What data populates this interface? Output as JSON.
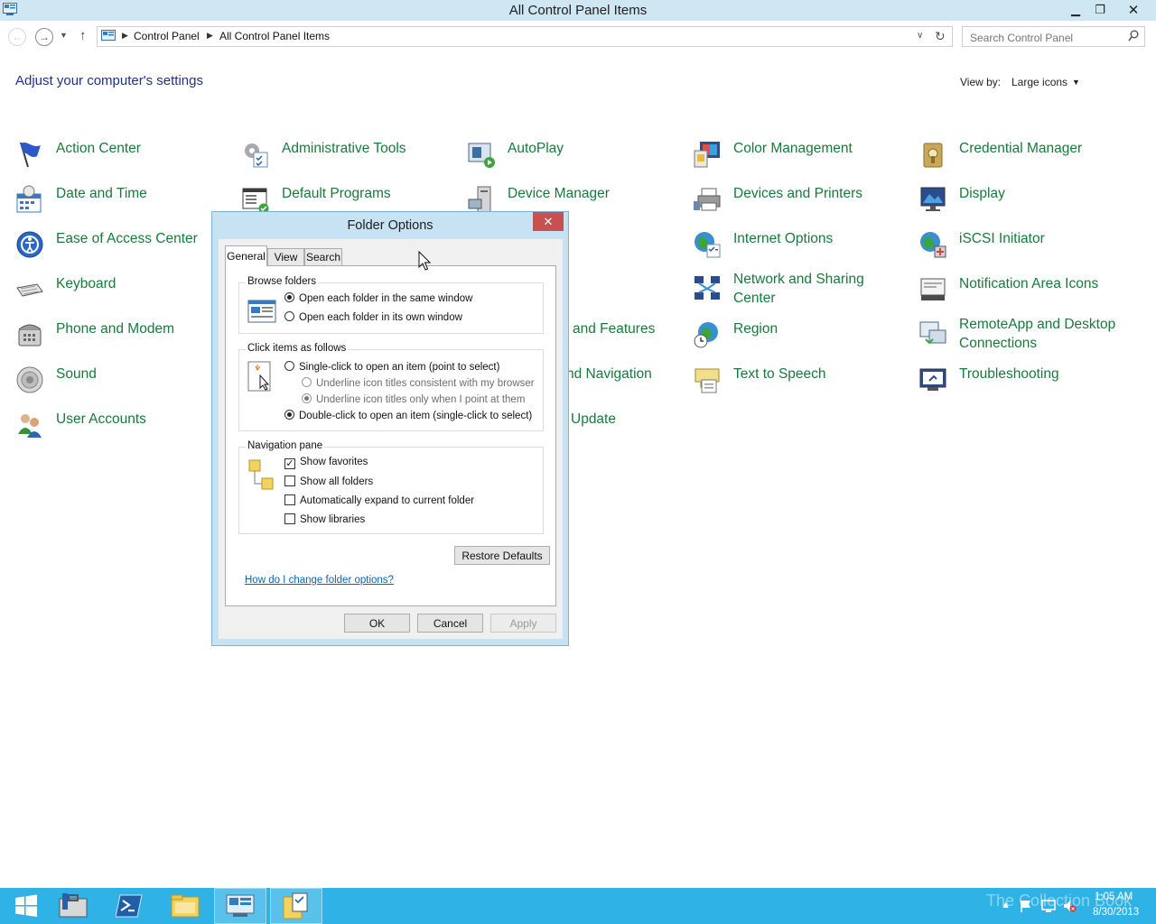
{
  "window": {
    "title": "All Control Panel Items",
    "minimize_glyph": "▁",
    "maximize_glyph": "❐",
    "close_glyph": "✕"
  },
  "address_bar": {
    "back_glyph": "←",
    "forward_glyph": "→",
    "recent_glyph": "▼",
    "up_glyph": "↑",
    "breadcrumbs": [
      "Control Panel",
      "All Control Panel Items"
    ],
    "separator_glyph": "▶",
    "dropdown_glyph": "∨",
    "refresh_glyph": "↻",
    "search_placeholder": "Search Control Panel"
  },
  "header": {
    "title": "Adjust your computer's settings",
    "view_by_label": "View by:",
    "view_by_value": "Large icons",
    "view_by_dropdown_glyph": "▼"
  },
  "items": [
    {
      "label": "Action Center",
      "icon": "flag-icon"
    },
    {
      "label": "Administrative Tools",
      "icon": "admin-tools-icon"
    },
    {
      "label": "AutoPlay",
      "icon": "autoplay-icon"
    },
    {
      "label": "Color Management",
      "icon": "color-management-icon"
    },
    {
      "label": "Credential Manager",
      "icon": "credential-manager-icon"
    },
    {
      "label": "Date and Time",
      "icon": "calendar-clock-icon"
    },
    {
      "label": "Default Programs",
      "icon": "default-programs-icon"
    },
    {
      "label": "Device Manager",
      "icon": "device-manager-icon"
    },
    {
      "label": "Devices and Printers",
      "icon": "printer-icon"
    },
    {
      "label": "Display",
      "icon": "monitor-icon"
    },
    {
      "label": "Ease of Access Center",
      "icon": "ease-of-access-icon"
    },
    {
      "label": "Internet Options",
      "icon": "globe-checklist-icon"
    },
    {
      "label": "iSCSI Initiator",
      "icon": "iscsi-globe-icon"
    },
    {
      "label": "Keyboard",
      "icon": "keyboard-icon"
    },
    {
      "label": "Network and Sharing Center",
      "icon": "network-icon"
    },
    {
      "label": "Notification Area Icons",
      "icon": "notification-area-icon"
    },
    {
      "label": "Phone and Modem",
      "icon": "phone-icon"
    },
    {
      "label": "and Features",
      "icon": ""
    },
    {
      "label": "Region",
      "icon": "region-globe-icon"
    },
    {
      "label": "RemoteApp and Desktop Connections",
      "icon": "remoteapp-icon"
    },
    {
      "label": "Sound",
      "icon": "speaker-icon"
    },
    {
      "label": "nd Navigation",
      "icon": ""
    },
    {
      "label": "Text to Speech",
      "icon": "speech-bubble-icon"
    },
    {
      "label": "Troubleshooting",
      "icon": "troubleshooting-icon"
    },
    {
      "label": "User Accounts",
      "icon": "users-icon"
    },
    {
      "label": "Update",
      "icon": ""
    }
  ],
  "dialog": {
    "title": "Folder Options",
    "close_glyph": "✕",
    "tabs": [
      "General",
      "View",
      "Search"
    ],
    "browse_folders": {
      "legend": "Browse folders",
      "options": [
        {
          "label": "Open each folder in the same window",
          "selected": true
        },
        {
          "label": "Open each folder in its own window",
          "selected": false
        }
      ]
    },
    "click_items": {
      "legend": "Click items as follows",
      "single_click": {
        "label": "Single-click to open an item (point to select)",
        "selected": false
      },
      "underline_options": [
        {
          "label": "Underline icon titles consistent with my browser",
          "selected": false
        },
        {
          "label": "Underline icon titles only when I point at them",
          "selected": true
        }
      ],
      "double_click": {
        "label": "Double-click to open an item (single-click to select)",
        "selected": true
      }
    },
    "navigation_pane": {
      "legend": "Navigation pane",
      "options": [
        {
          "label": "Show favorites",
          "checked": true
        },
        {
          "label": "Show all folders",
          "checked": false
        },
        {
          "label": "Automatically expand to current folder",
          "checked": false
        },
        {
          "label": "Show libraries",
          "checked": false
        }
      ]
    },
    "restore_defaults": "Restore Defaults",
    "help_link": "How do I change folder options?",
    "ok": "OK",
    "cancel": "Cancel",
    "apply": "Apply"
  },
  "taskbar": {
    "time": "1:05 AM",
    "date": "8/30/2013",
    "watermark": "The Collection Book",
    "items": [
      "start-icon",
      "server-manager-icon",
      "powershell-icon",
      "file-explorer-icon",
      "control-panel-icon",
      "folder-options-icon"
    ]
  },
  "colors": {
    "link_green": "#177a3b",
    "heading_blue": "#1e3287",
    "titlebar": "#cfe6f3",
    "taskbar": "#2fb3e6",
    "dialog_close": "#c75050"
  }
}
